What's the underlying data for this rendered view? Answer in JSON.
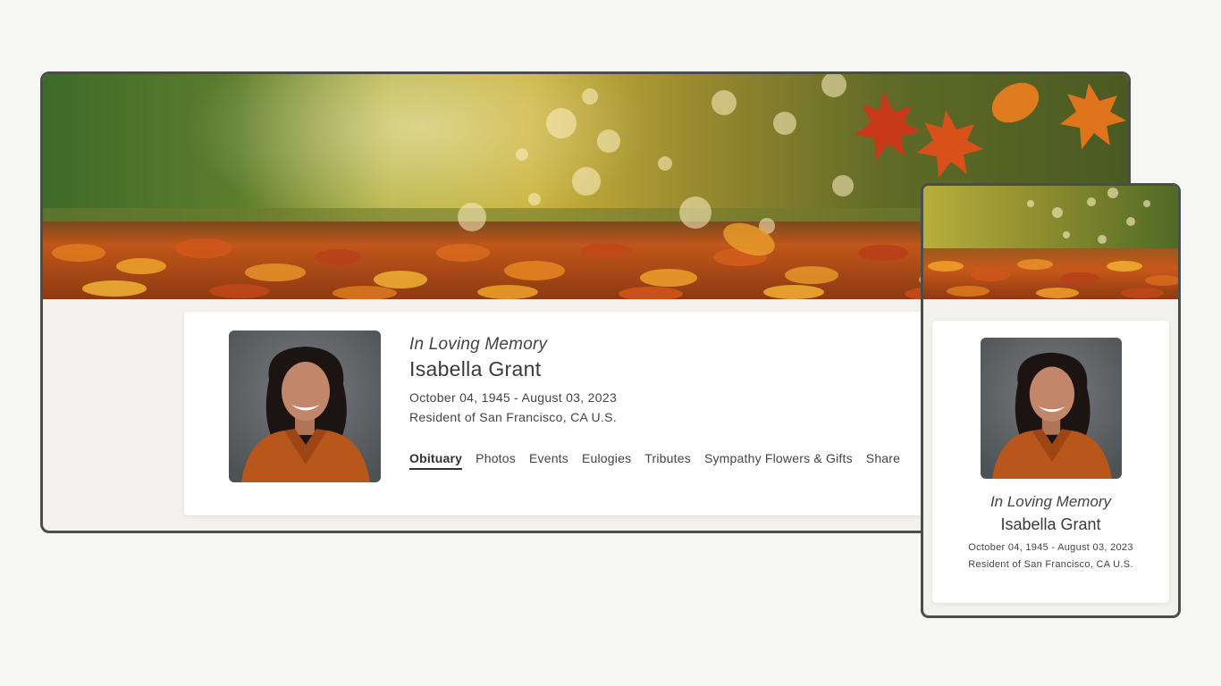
{
  "desktop": {
    "heading": "In Loving Memory",
    "name": "Isabella Grant",
    "dates": "October 04, 1945 - August 03, 2023",
    "resident": "Resident of San Francisco, CA U.S.",
    "tabs": [
      {
        "label": "Obituary",
        "active": true
      },
      {
        "label": "Photos"
      },
      {
        "label": "Events"
      },
      {
        "label": "Eulogies"
      },
      {
        "label": "Tributes"
      },
      {
        "label": "Sympathy Flowers & Gifts"
      },
      {
        "label": "Share"
      }
    ]
  },
  "mobile": {
    "heading": "In Loving Memory",
    "name": "Isabella Grant",
    "dates": "October 04, 1945 - August 03, 2023",
    "resident": "Resident of San Francisco, CA U.S."
  },
  "colors": {
    "frame_border": "#4a4d48",
    "page_background": "#f6f6f5",
    "card_background": "#ffffff",
    "blouse": "#b8561c"
  },
  "banner_image": "autumn-leaves-banner",
  "portrait_image": "woman-portrait"
}
